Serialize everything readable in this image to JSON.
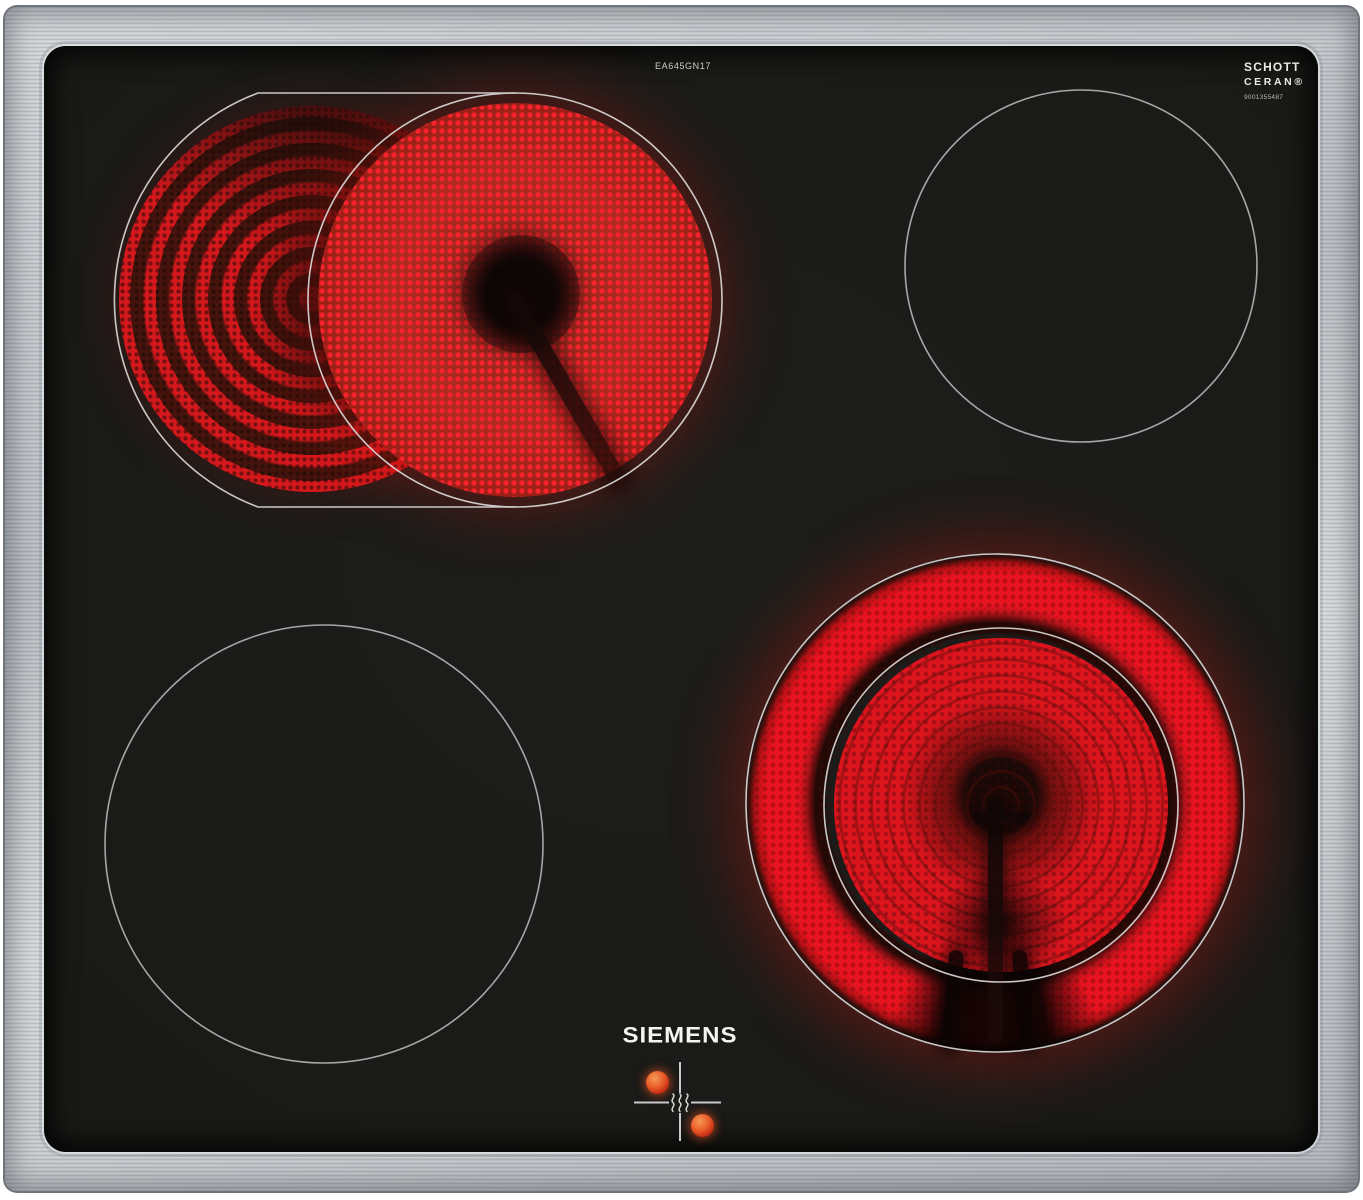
{
  "image_type": "product-photo",
  "subject": "built-in glass-ceramic cooktop with stainless steel frame, two zones glowing red",
  "labels": {
    "model": "EA645GN17",
    "schott_line1": "SCHOTT",
    "schott_line2": "CERAN®",
    "serial": "9001355487",
    "brand": "SIEMENS"
  },
  "zones": [
    {
      "position": "rear-left",
      "type": "dual roasting zone (two overlapping elements)",
      "state": "on",
      "glow": "red"
    },
    {
      "position": "rear-right",
      "type": "single radiant zone",
      "state": "off"
    },
    {
      "position": "front-left",
      "type": "single radiant zone",
      "state": "off"
    },
    {
      "position": "front-right",
      "type": "dual-circuit radiant zone (ring + disc)",
      "state": "on",
      "glow": "red"
    }
  ],
  "indicators": {
    "residual_heat_cross": true,
    "heat_symbol": "≋",
    "lit_dots": 2,
    "dot_color": "#e85a28"
  },
  "colors": {
    "background": "#ffffff",
    "steel_frame": "#bcc0c4",
    "glass": "#1a1a18",
    "element_red": "#e8131e",
    "outline_white": "#dededd"
  }
}
